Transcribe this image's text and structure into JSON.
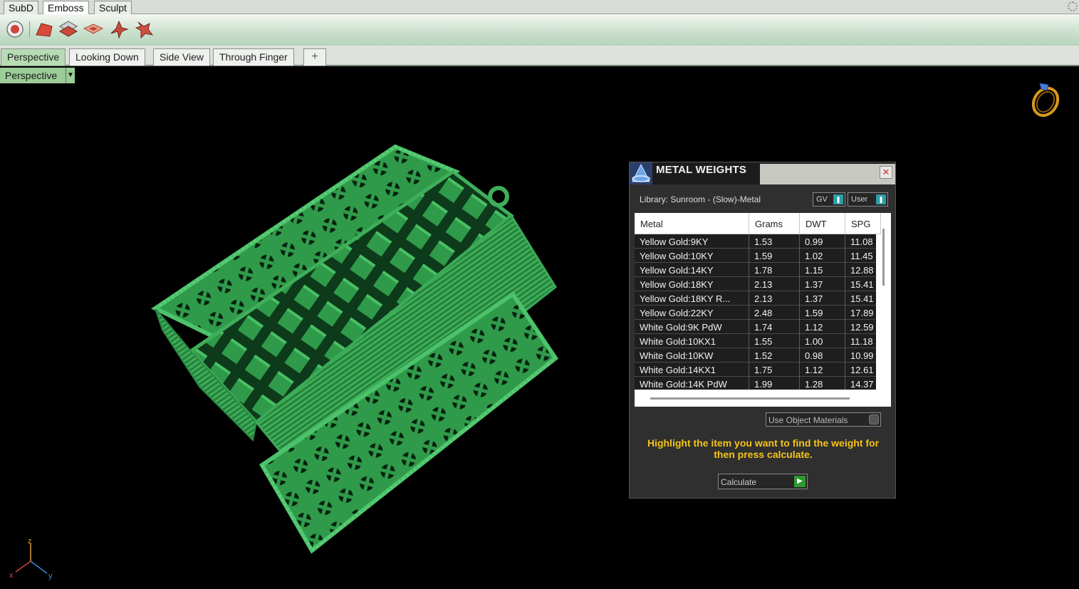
{
  "top_tabs": [
    "SubD",
    "Emboss",
    "Sculpt"
  ],
  "top_tab_active": "Emboss",
  "toolbar_icons": [
    "record-icon",
    "emboss-surface-icon",
    "emboss-layers-icon",
    "emboss-plane-icon",
    "emboss-figure-icon",
    "emboss-tools-icon"
  ],
  "view_tabs": [
    "Perspective",
    "Looking Down",
    "Side View",
    "Through Finger"
  ],
  "view_tab_add": "+",
  "viewport": {
    "label": "Perspective",
    "axis_x": "x",
    "axis_y": "y",
    "axis_z": "z"
  },
  "panel": {
    "title": "METAL WEIGHTS",
    "library": "Library: Sunroom - (Slow)-Metal",
    "gv_select": "GV",
    "user_select": "User",
    "columns": [
      "Metal",
      "Grams",
      "DWT",
      "SPG"
    ],
    "rows": [
      [
        "Yellow Gold:9KY",
        "1.53",
        "0.99",
        "11.08"
      ],
      [
        "Yellow Gold:10KY",
        "1.59",
        "1.02",
        "11.45"
      ],
      [
        "Yellow Gold:14KY",
        "1.78",
        "1.15",
        "12.88"
      ],
      [
        "Yellow Gold:18KY",
        "2.13",
        "1.37",
        "15.41"
      ],
      [
        "Yellow Gold:18KY R...",
        "2.13",
        "1.37",
        "15.41"
      ],
      [
        "Yellow Gold:22KY",
        "2.48",
        "1.59",
        "17.89"
      ],
      [
        "White Gold:9K PdW",
        "1.74",
        "1.12",
        "12.59"
      ],
      [
        "White Gold:10KX1",
        "1.55",
        "1.00",
        "11.18"
      ],
      [
        "White Gold:10KW",
        "1.52",
        "0.98",
        "10.99"
      ],
      [
        "White Gold:14KX1",
        "1.75",
        "1.12",
        "12.61"
      ],
      [
        "White Gold:14K PdW",
        "1.99",
        "1.28",
        "14.37"
      ]
    ],
    "use_object_materials": "Use Object Materials",
    "instruction": "Highlight the item you want to find the weight for then press calculate.",
    "calculate": "Calculate"
  },
  "colors": {
    "model_green": "#2f9a4a",
    "viewport_label_bg": "#9ccc98",
    "instruction_yellow": "#f5c518"
  }
}
